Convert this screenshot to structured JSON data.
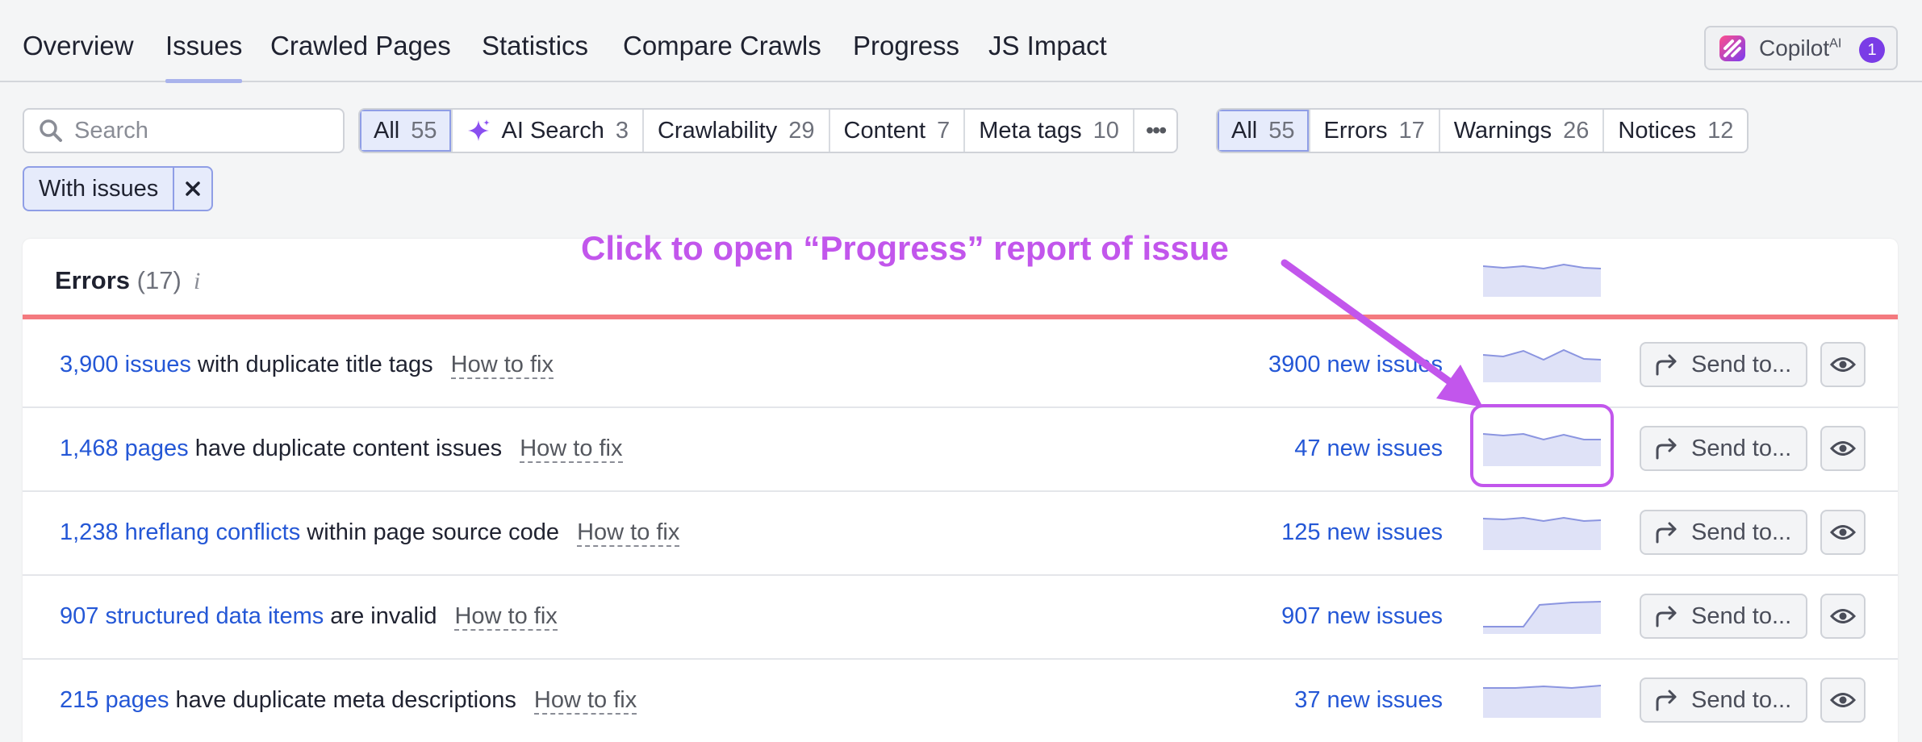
{
  "nav": {
    "tabs": [
      {
        "label": "Overview"
      },
      {
        "label": "Issues"
      },
      {
        "label": "Crawled Pages"
      },
      {
        "label": "Statistics"
      },
      {
        "label": "Compare Crawls"
      },
      {
        "label": "Progress"
      },
      {
        "label": "JS Impact"
      }
    ],
    "active_tab": "Issues",
    "copilot": {
      "label": "Copilot",
      "sup": "AI",
      "badge": "1"
    }
  },
  "filters": {
    "search_placeholder": "Search",
    "categories": [
      {
        "label": "All",
        "count": "55"
      },
      {
        "label": "AI Search",
        "count": "3"
      },
      {
        "label": "Crawlability",
        "count": "29"
      },
      {
        "label": "Content",
        "count": "7"
      },
      {
        "label": "Meta tags",
        "count": "10"
      }
    ],
    "more_label": "•••",
    "types": [
      {
        "label": "All",
        "count": "55"
      },
      {
        "label": "Errors",
        "count": "17"
      },
      {
        "label": "Warnings",
        "count": "26"
      },
      {
        "label": "Notices",
        "count": "12"
      }
    ],
    "active_chip": "With issues"
  },
  "errors_section": {
    "title": "Errors",
    "count": "(17)",
    "info": "i",
    "rows": [
      {
        "link": "3,900 issues",
        "text": " with duplicate title tags",
        "how_to_fix": "How to fix",
        "new_issues": "3900 new issues",
        "send": "Send to..."
      },
      {
        "link": "1,468 pages",
        "text": " have duplicate content issues",
        "how_to_fix": "How to fix",
        "new_issues": "47 new issues",
        "send": "Send to..."
      },
      {
        "link": "1,238 hreflang conflicts",
        "text": " within page source code",
        "how_to_fix": "How to fix",
        "new_issues": "125 new issues",
        "send": "Send to..."
      },
      {
        "link": "907 structured data items",
        "text": " are invalid",
        "how_to_fix": "How to fix",
        "new_issues": "907 new issues",
        "send": "Send to..."
      },
      {
        "link": "215 pages",
        "text": " have duplicate meta descriptions",
        "how_to_fix": "How to fix",
        "new_issues": "37 new issues",
        "send": "Send to..."
      }
    ]
  },
  "annotation": {
    "text": "Click to open “Progress” report of issue",
    "color": "#c256ec"
  },
  "colors": {
    "link": "#2457d6",
    "error_bar": "#f47a7f",
    "selected_bg": "#e6ebfb"
  }
}
